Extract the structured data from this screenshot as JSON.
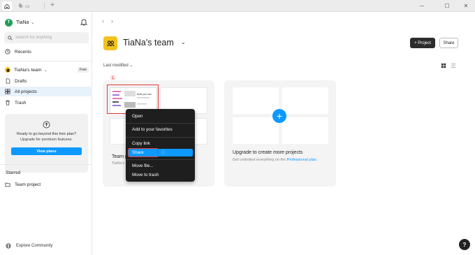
{
  "titlebar": {
    "tab_label": "",
    "tab_icon": "figma-icon",
    "min": "─",
    "max": "☐",
    "close": "✕",
    "plus": "+"
  },
  "sidebar": {
    "user": {
      "initial": "T",
      "name": "TiaNa"
    },
    "search_placeholder": "Search for anything",
    "recents": "Recents",
    "team": {
      "name": "TiaNa's team",
      "badge": "Free"
    },
    "items": [
      {
        "label": "Drafts"
      },
      {
        "label": "All projects"
      },
      {
        "label": "Trash"
      }
    ],
    "promo": {
      "line1": "Ready to go beyond this free plan?",
      "line2": "Upgrade for premium features.",
      "button": "View plans"
    },
    "starred_heading": "Starred",
    "starred_items": [
      {
        "label": "Team project"
      }
    ],
    "explore": "Explore Community"
  },
  "main": {
    "nav_back": "‹",
    "nav_forward": "›",
    "team_title": "TiaNa's team",
    "btn_project": "+ Project",
    "btn_share": "Share",
    "sort_label": "Last modified",
    "project_card": {
      "title": "Team p",
      "sub": "TiaNa's",
      "thumb_text": "Build your own"
    },
    "upgrade_card": {
      "title": "Upgrade to create more projects",
      "sub_prefix": "Get unlimited everything on the ",
      "sub_link": "Professional plan",
      "sub_suffix": "."
    },
    "annotations": {
      "one": "①",
      "two": "②"
    },
    "context_menu": [
      {
        "label": "Open"
      },
      {
        "label": "Add to your favorites"
      },
      {
        "label": "Copy link"
      },
      {
        "label": "Share"
      },
      {
        "label": "Move file..."
      },
      {
        "label": "Move to trash"
      }
    ],
    "help": "?"
  },
  "colors": {
    "accent": "#0d99ff",
    "team": "#f4c21f",
    "annotation": "#e53935",
    "menu_bg": "#1e1e1e"
  }
}
